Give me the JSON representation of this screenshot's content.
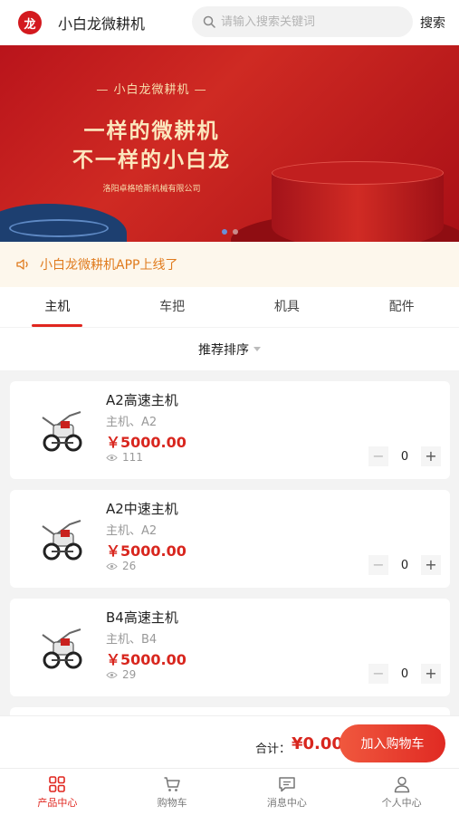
{
  "header": {
    "app_title": "小白龙微耕机",
    "logo_text": "龙",
    "search_placeholder": "请输入搜索关键词",
    "search_button": "搜索"
  },
  "banner": {
    "tagline": "— 小白龙微耕机 —",
    "headline_1": "一样的微耕机",
    "headline_2": "不一样的小白龙",
    "company": "洛阳卓格哈斯机械有限公司",
    "slide_count": 2,
    "active_slide": 0
  },
  "notice": {
    "icon": "speaker-icon",
    "text": "小白龙微耕机APP上线了"
  },
  "tabs": [
    {
      "label": "主机",
      "active": true
    },
    {
      "label": "车把",
      "active": false
    },
    {
      "label": "机具",
      "active": false
    },
    {
      "label": "配件",
      "active": false
    }
  ],
  "sort": {
    "label": "推荐排序"
  },
  "products": [
    {
      "name": "A2高速主机",
      "tags": "主机、A2",
      "price": "￥5000.00",
      "views": "111",
      "quantity": "0"
    },
    {
      "name": "A2中速主机",
      "tags": "主机、A2",
      "price": "￥5000.00",
      "views": "26",
      "quantity": "0"
    },
    {
      "name": "B4高速主机",
      "tags": "主机、B4",
      "price": "￥5000.00",
      "views": "29",
      "quantity": "0"
    }
  ],
  "checkout": {
    "total_label": "合计：",
    "total_value": "¥0.00",
    "add_to_cart": "加入购物车"
  },
  "bottom_nav": [
    {
      "label": "产品中心",
      "icon": "grid-icon",
      "active": true
    },
    {
      "label": "购物车",
      "icon": "cart-icon",
      "active": false
    },
    {
      "label": "消息中心",
      "icon": "message-icon",
      "active": false
    },
    {
      "label": "个人中心",
      "icon": "user-icon",
      "active": false
    }
  ],
  "colors": {
    "brand_red": "#e0261f",
    "price_red": "#d8261e",
    "notice_orange": "#e07b1e",
    "banner_gold": "#fbe6bd"
  }
}
